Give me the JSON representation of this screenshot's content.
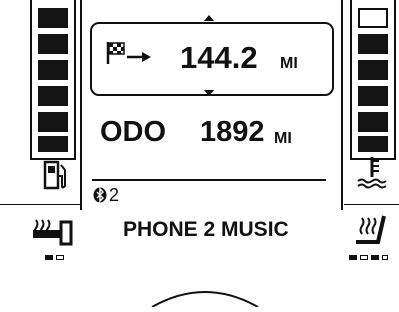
{
  "trip": {
    "value": "144.2",
    "unit": "MI",
    "flag_icon": "checkered-flag-icon",
    "arrow_icon": "right-arrow-icon"
  },
  "odo": {
    "label": "ODO",
    "value": "1892",
    "unit": "MI"
  },
  "phone": {
    "bluetooth_icon": "bluetooth-icon",
    "number": "2",
    "label": "PHONE 2 MUSIC"
  },
  "fuel_gauge": {
    "icon": "fuel-pump-icon",
    "level_fraction": 1.0
  },
  "temp_gauge": {
    "icon": "coolant-temperature-icon",
    "level_fraction": 0.86
  },
  "left_heater": {
    "icon": "heated-grip-icon",
    "level": "1 of 2"
  },
  "right_heater": {
    "icon": "heated-seat-icon",
    "level": "2 of 3"
  }
}
